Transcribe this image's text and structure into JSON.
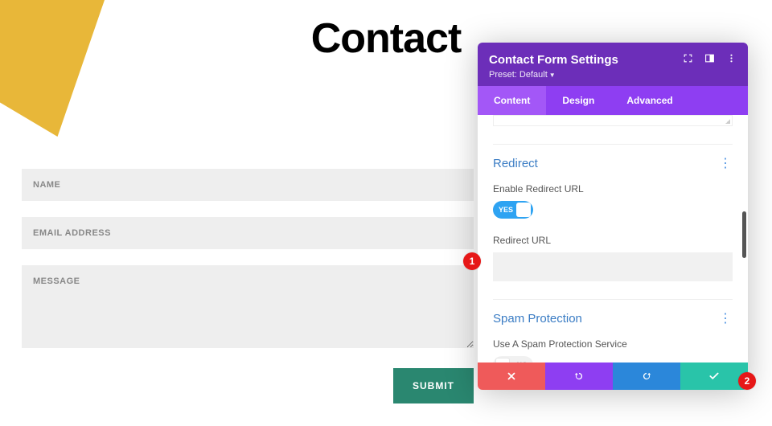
{
  "page": {
    "title": "Contact"
  },
  "form": {
    "name_placeholder": "NAME",
    "email_placeholder": "EMAIL ADDRESS",
    "message_placeholder": "MESSAGE",
    "submit_label": "SUBMIT"
  },
  "panel": {
    "title": "Contact Form Settings",
    "preset_prefix": "Preset: ",
    "preset_value": "Default",
    "tabs": {
      "content": "Content",
      "design": "Design",
      "advanced": "Advanced"
    },
    "redirect": {
      "section": "Redirect",
      "enable_label": "Enable Redirect URL",
      "enable_state": "YES",
      "url_label": "Redirect URL",
      "url_value": ""
    },
    "spam": {
      "section": "Spam Protection",
      "service_label": "Use A Spam Protection Service",
      "service_state": "NO"
    }
  },
  "annotations": {
    "badge1": "1",
    "badge2": "2"
  }
}
